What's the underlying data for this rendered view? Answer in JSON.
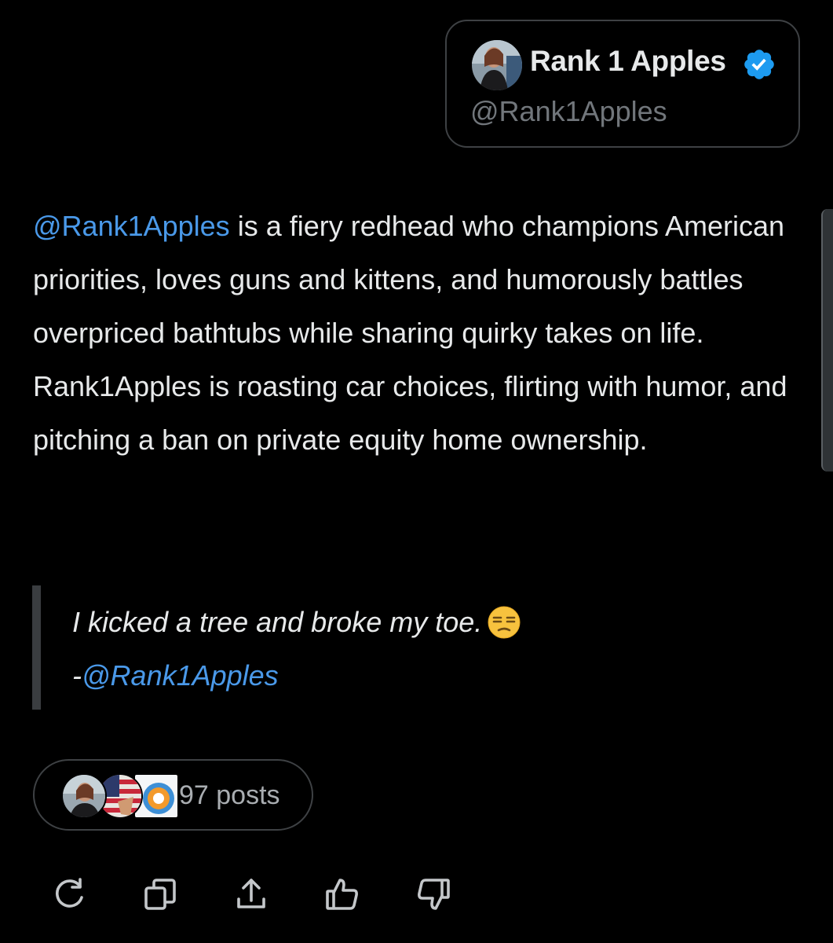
{
  "profile": {
    "name": "Rank 1 Apples",
    "handle": "@Rank1Apples",
    "verified_icon": "verified-badge-icon",
    "accent": "#1d9bf0"
  },
  "summary": {
    "mention": "@Rank1Apples",
    "part1_rest": " is a fiery redhead who champions American priorities, loves guns and kittens, and humorously battles overpriced bathtubs while sharing quirky takes on life.",
    "part2": "Rank1Apples is roasting car choices, flirting with humor, and pitching a ban on private equity home ownership."
  },
  "quote": {
    "text": "I kicked a tree and broke my toe.",
    "emoji_icon": "unamused-face-emoji",
    "attribution_prefix": "-",
    "attribution_handle": "@Rank1Apples"
  },
  "posts_pill": {
    "label": "97 posts"
  },
  "actions": [
    {
      "name": "regenerate-button",
      "icon": "refresh-icon"
    },
    {
      "name": "copy-button",
      "icon": "copy-icon"
    },
    {
      "name": "share-button",
      "icon": "share-icon"
    },
    {
      "name": "thumbs-up-button",
      "icon": "thumbs-up-icon"
    },
    {
      "name": "thumbs-down-button",
      "icon": "thumbs-down-icon"
    }
  ],
  "colors": {
    "background": "#000000",
    "text": "#e7e9ea",
    "muted": "#71767b",
    "link": "#4a99e9",
    "border": "#3e4144"
  }
}
